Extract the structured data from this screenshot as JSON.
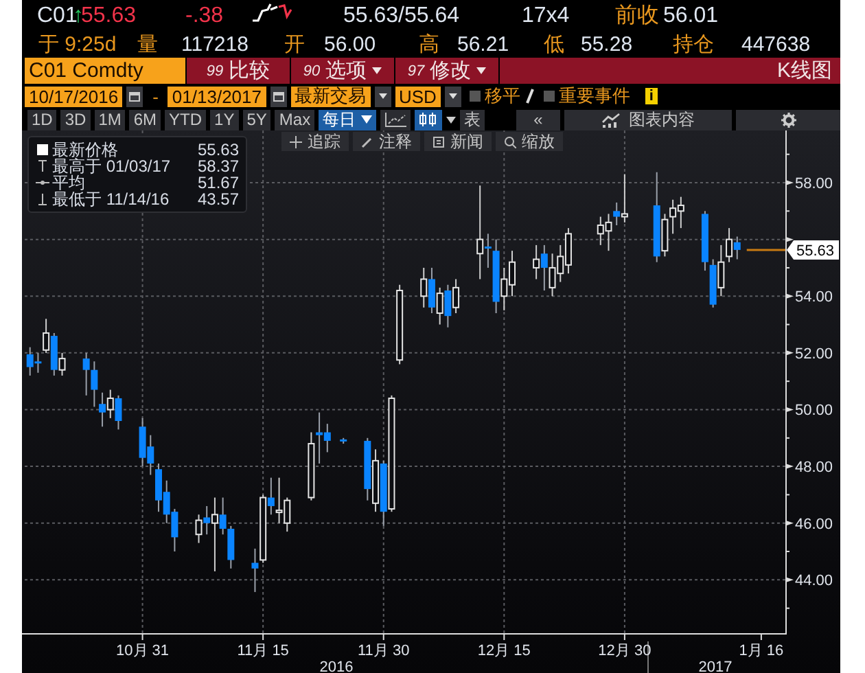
{
  "quote": {
    "ticker": "C01",
    "arrow": "↑",
    "last": "55.63",
    "change": "-.38",
    "bid_ask": "55.63/55.64",
    "size": "17x4",
    "prev_close_label": "前收",
    "prev_close": "56.01"
  },
  "session": {
    "time": "于 9:25d",
    "stats": [
      {
        "label": "量",
        "value": "117218"
      },
      {
        "label": "开",
        "value": "56.00"
      },
      {
        "label": "高",
        "value": "56.21"
      },
      {
        "label": "低",
        "value": "55.28"
      },
      {
        "label": "持仓",
        "value": "447638"
      }
    ]
  },
  "command_bar": {
    "security": "C01 Comdty",
    "actions": [
      {
        "code": "99",
        "label": "比较",
        "dropdown": false
      },
      {
        "code": "90",
        "label": "选项",
        "dropdown": true
      },
      {
        "code": "97",
        "label": "修改",
        "dropdown": true
      }
    ],
    "view_title": "K线图"
  },
  "date_row": {
    "start": "10/17/2016",
    "separator": "-",
    "end": "01/13/2017",
    "field": "最新交易",
    "currency": "USD",
    "toggles": [
      {
        "label": "移平",
        "checked": false
      },
      {
        "label": "重要事件",
        "checked": false
      }
    ],
    "info": "i"
  },
  "period_row": {
    "periods": [
      "1D",
      "3D",
      "1M",
      "6M",
      "YTD",
      "1Y",
      "5Y",
      "Max"
    ],
    "frequency": "每日",
    "table_label": "表",
    "collapse": "«",
    "chart_content": "图表内容"
  },
  "chart_tools": [
    {
      "kind": "track",
      "label": "追踪"
    },
    {
      "kind": "annotate",
      "label": "注释"
    },
    {
      "kind": "news",
      "label": "新闻"
    },
    {
      "kind": "zoom",
      "label": "缩放"
    }
  ],
  "legend": [
    {
      "kind": "last",
      "label": "最新价格",
      "value": "55.63"
    },
    {
      "kind": "high",
      "label": "最高于 01/03/17",
      "value": "58.37"
    },
    {
      "kind": "average",
      "label": "平均",
      "value": "51.67"
    },
    {
      "kind": "low",
      "label": "最低于 11/14/16",
      "value": "43.57"
    }
  ],
  "chart": {
    "price_tag": "55.63",
    "years": [
      "2016",
      "2017"
    ],
    "chart_data": {
      "type": "candlestick",
      "grid": true,
      "xlim": [
        "2016-10-16",
        "2017-01-19"
      ],
      "xticks": [
        {
          "value": "2016-10-31",
          "label": "10月 31"
        },
        {
          "value": "2016-11-15",
          "label": "11月 15"
        },
        {
          "value": "2016-11-30",
          "label": "11月 30"
        },
        {
          "value": "2016-12-15",
          "label": "12月 15"
        },
        {
          "value": "2016-12-30",
          "label": "12月 30"
        },
        {
          "value": "2017-01-16",
          "label": "1月 16"
        }
      ],
      "x": [
        "2016-10-17",
        "2016-10-18",
        "2016-10-19",
        "2016-10-20",
        "2016-10-21",
        "2016-10-24",
        "2016-10-25",
        "2016-10-26",
        "2016-10-27",
        "2016-10-28",
        "2016-10-31",
        "2016-11-01",
        "2016-11-02",
        "2016-11-03",
        "2016-11-04",
        "2016-11-07",
        "2016-11-08",
        "2016-11-09",
        "2016-11-10",
        "2016-11-11",
        "2016-11-14",
        "2016-11-15",
        "2016-11-16",
        "2016-11-17",
        "2016-11-18",
        "2016-11-21",
        "2016-11-22",
        "2016-11-23",
        "2016-11-25",
        "2016-11-28",
        "2016-11-29",
        "2016-11-30",
        "2016-12-01",
        "2016-12-02",
        "2016-12-05",
        "2016-12-06",
        "2016-12-07",
        "2016-12-08",
        "2016-12-09",
        "2016-12-12",
        "2016-12-13",
        "2016-12-14",
        "2016-12-15",
        "2016-12-16",
        "2016-12-19",
        "2016-12-20",
        "2016-12-21",
        "2016-12-22",
        "2016-12-23",
        "2016-12-27",
        "2016-12-28",
        "2016-12-29",
        "2016-12-30",
        "2017-01-03",
        "2017-01-04",
        "2017-01-05",
        "2017-01-06",
        "2017-01-09",
        "2017-01-10",
        "2017-01-11",
        "2017-01-12",
        "2017-01-13"
      ],
      "ohlc": [
        [
          51.95,
          52.2,
          51.2,
          51.5
        ],
        [
          51.7,
          52.0,
          51.3,
          51.65
        ],
        [
          52.1,
          53.2,
          52.0,
          52.7
        ],
        [
          52.6,
          52.7,
          51.2,
          51.4
        ],
        [
          51.4,
          52.0,
          51.2,
          51.8
        ],
        [
          51.8,
          52.0,
          50.5,
          51.4
        ],
        [
          51.4,
          51.7,
          50.1,
          50.7
        ],
        [
          50.2,
          50.6,
          49.4,
          49.9
        ],
        [
          50.0,
          50.7,
          49.7,
          50.4
        ],
        [
          50.4,
          50.5,
          49.3,
          49.6
        ],
        [
          49.4,
          49.7,
          48.0,
          48.3
        ],
        [
          48.7,
          49.1,
          47.7,
          48.1
        ],
        [
          47.9,
          48.1,
          46.4,
          46.8
        ],
        [
          47.1,
          47.5,
          46.0,
          46.3
        ],
        [
          46.4,
          46.5,
          45.0,
          45.5
        ],
        [
          45.6,
          46.3,
          45.3,
          46.1
        ],
        [
          46.2,
          46.6,
          45.6,
          46.0
        ],
        [
          46.0,
          46.9,
          44.3,
          46.3
        ],
        [
          46.3,
          46.9,
          45.6,
          45.8
        ],
        [
          45.8,
          45.9,
          44.4,
          44.7
        ],
        [
          44.6,
          45.1,
          43.57,
          44.4
        ],
        [
          44.7,
          47.0,
          44.6,
          46.9
        ],
        [
          46.9,
          47.6,
          46.3,
          46.6
        ],
        [
          46.4,
          47.6,
          46.0,
          46.45
        ],
        [
          46.0,
          46.9,
          45.7,
          46.8
        ],
        [
          46.9,
          49.2,
          46.8,
          48.8
        ],
        [
          49.2,
          49.9,
          48.1,
          49.1
        ],
        [
          49.2,
          49.5,
          48.5,
          48.9
        ],
        [
          48.95,
          49.0,
          48.8,
          48.9
        ],
        [
          48.9,
          49.0,
          46.8,
          47.2
        ],
        [
          46.7,
          48.6,
          46.4,
          48.2
        ],
        [
          48.1,
          48.2,
          45.9,
          46.4
        ],
        [
          46.5,
          50.5,
          46.4,
          50.4
        ],
        [
          51.75,
          54.4,
          51.6,
          54.2
        ],
        [
          54.0,
          55.0,
          53.6,
          54.6
        ],
        [
          54.6,
          55.0,
          53.4,
          53.6
        ],
        [
          53.4,
          54.3,
          53.0,
          54.1
        ],
        [
          54.2,
          54.4,
          52.9,
          53.3
        ],
        [
          53.6,
          54.6,
          53.4,
          54.3
        ],
        [
          55.5,
          57.9,
          54.6,
          56.0
        ],
        [
          55.75,
          56.2,
          55.0,
          55.68
        ],
        [
          55.6,
          56.0,
          53.4,
          53.8
        ],
        [
          54.0,
          55.0,
          53.5,
          54.6
        ],
        [
          54.4,
          55.6,
          54.0,
          55.2
        ],
        [
          55.0,
          55.8,
          54.6,
          55.3
        ],
        [
          55.5,
          55.8,
          54.2,
          55.0
        ],
        [
          54.3,
          55.5,
          54.0,
          55.0
        ],
        [
          54.8,
          55.8,
          54.5,
          55.4
        ],
        [
          55.1,
          56.4,
          54.8,
          56.2
        ],
        [
          56.2,
          56.8,
          55.8,
          56.5
        ],
        [
          56.3,
          56.9,
          55.6,
          56.6
        ],
        [
          57.0,
          57.3,
          56.5,
          56.8
        ],
        [
          56.8,
          58.3,
          56.6,
          56.9
        ],
        [
          57.2,
          58.37,
          55.2,
          55.4
        ],
        [
          55.6,
          56.9,
          55.4,
          56.7
        ],
        [
          56.8,
          57.4,
          56.2,
          57.1
        ],
        [
          57.0,
          57.5,
          56.4,
          57.2
        ],
        [
          56.9,
          57.0,
          54.9,
          55.2
        ],
        [
          55.1,
          55.3,
          53.6,
          53.7
        ],
        [
          54.3,
          55.8,
          54.0,
          55.2
        ],
        [
          55.4,
          56.4,
          55.2,
          56.0
        ],
        [
          55.9,
          56.1,
          55.3,
          55.63
        ]
      ],
      "ylim": [
        42.12,
        59.84
      ],
      "yticks": [
        {
          "value": 58,
          "label": "58.00"
        },
        {
          "value": 54,
          "label": "54.00"
        },
        {
          "value": 52,
          "label": "52.00"
        },
        {
          "value": 50,
          "label": "50.00"
        },
        {
          "value": 48,
          "label": "48.00"
        },
        {
          "value": 46,
          "label": "46.00"
        },
        {
          "value": 44,
          "label": "44.00"
        }
      ]
    }
  }
}
